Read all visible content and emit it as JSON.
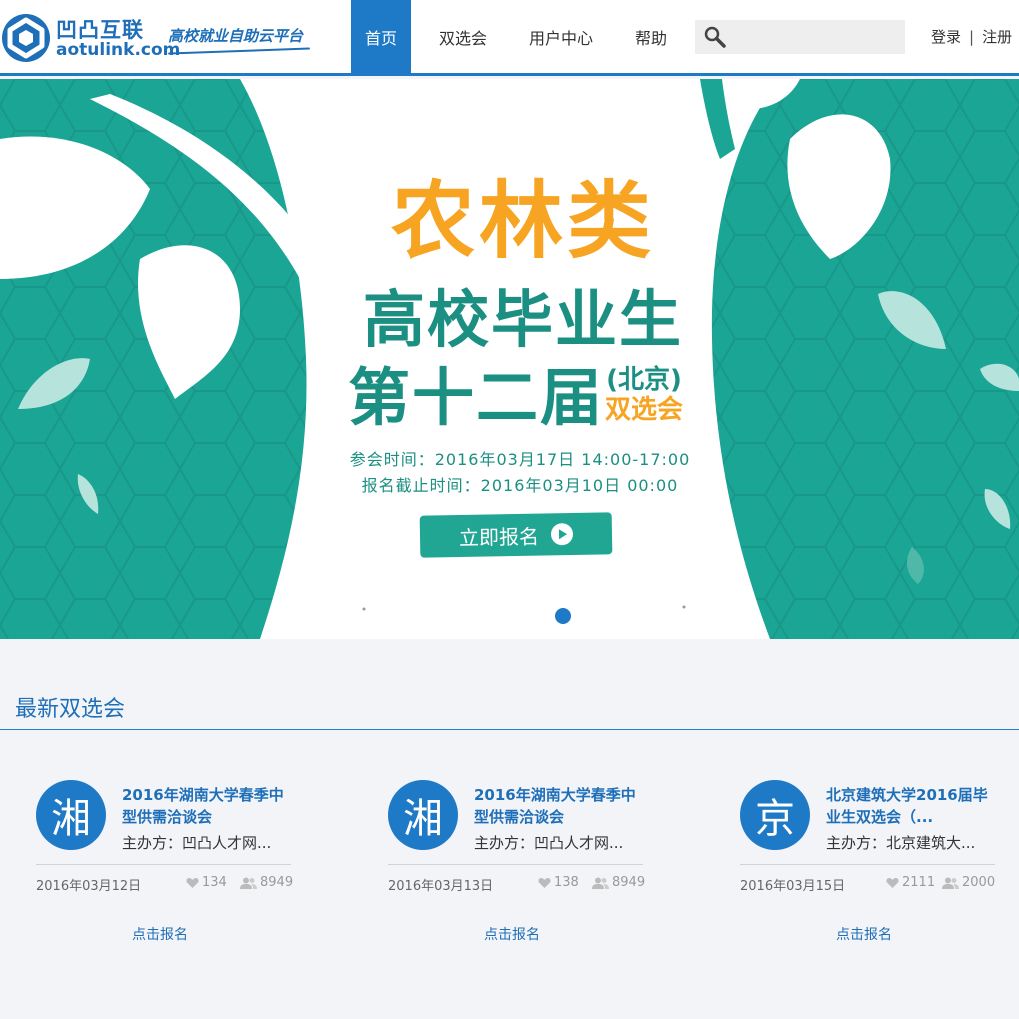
{
  "brand": {
    "name": "凹凸互联",
    "domain": "aotulink.com",
    "slogan": "高校就业自助云平台"
  },
  "nav": {
    "items": [
      {
        "label": "首页",
        "active": true
      },
      {
        "label": "双选会"
      },
      {
        "label": "用户中心"
      },
      {
        "label": "帮助"
      }
    ]
  },
  "search": {
    "placeholder": "",
    "icon": "search-icon"
  },
  "auth": {
    "login": "登录",
    "separator": "|",
    "register": "注册"
  },
  "banner": {
    "title_line1": "农林类",
    "title_line2": "高校毕业生",
    "title_line3": "第十二届",
    "city": "(北京)",
    "event_type": "双选会",
    "meeting_time": "参会时间：2016年03月17日 14:00-17:00",
    "deadline": "报名截止时间：2016年03月10日 00:00",
    "button": "立即报名"
  },
  "latest": {
    "title": "最新双选会",
    "cards": [
      {
        "avatar": "湘",
        "title": "2016年湖南大学春季中型供需洽谈会",
        "org": "主办方：凹凸人才网...",
        "date": "2016年03月12日",
        "likes": "134",
        "users": "8949",
        "signup": "点击报名"
      },
      {
        "avatar": "湘",
        "title": "2016年湖南大学春季中型供需洽谈会",
        "org": "主办方：凹凸人才网...",
        "date": "2016年03月13日",
        "likes": "138",
        "users": "8949",
        "signup": "点击报名"
      },
      {
        "avatar": "京",
        "title": "北京建筑大学2016届毕业生双选会（...",
        "org": "主办方：北京建筑大...",
        "date": "2016年03月15日",
        "likes": "2111",
        "users": "2000",
        "signup": "点击报名"
      }
    ]
  },
  "colors": {
    "brand_blue": "#1e7ac7",
    "teal": "#1aa595",
    "orange": "#f6a421",
    "dark_teal": "#1a8f82"
  }
}
